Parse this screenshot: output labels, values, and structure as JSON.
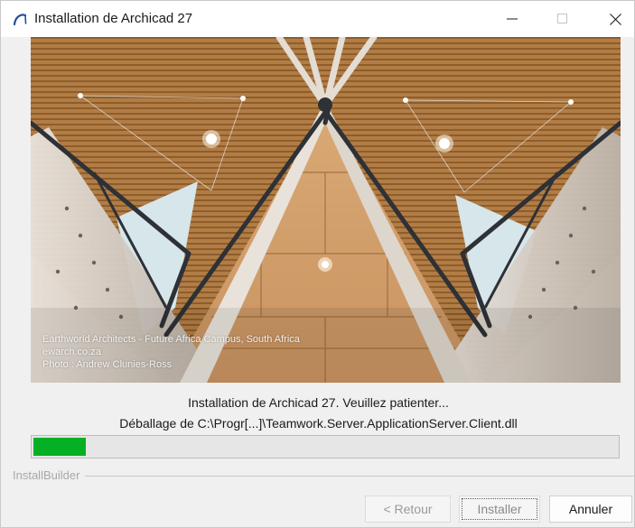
{
  "window": {
    "title": "Installation de Archicad 27",
    "icon": "archicad-arc-icon",
    "controls": [
      "minimize-icon",
      "maximize-icon",
      "close-icon"
    ]
  },
  "banner": {
    "credit_line_1": "Earthworld Architects - Future Africa Campus, South Africa",
    "credit_line_2": "ewarch.co.za",
    "credit_line_3": "Photo : Andrew Clunies-Ross"
  },
  "status": {
    "message": "Installation de Archicad 27. Veuillez patienter...",
    "detail": "Déballage de C:\\Progr[...]\\Teamwork.Server.ApplicationServer.Client.dll"
  },
  "progress": {
    "fraction": 0.09,
    "color": "#06b025"
  },
  "footer": {
    "group_label": "InstallBuilder"
  },
  "buttons": {
    "back_label": "< Retour",
    "install_label": "Installer",
    "cancel_label": "Annuler"
  }
}
